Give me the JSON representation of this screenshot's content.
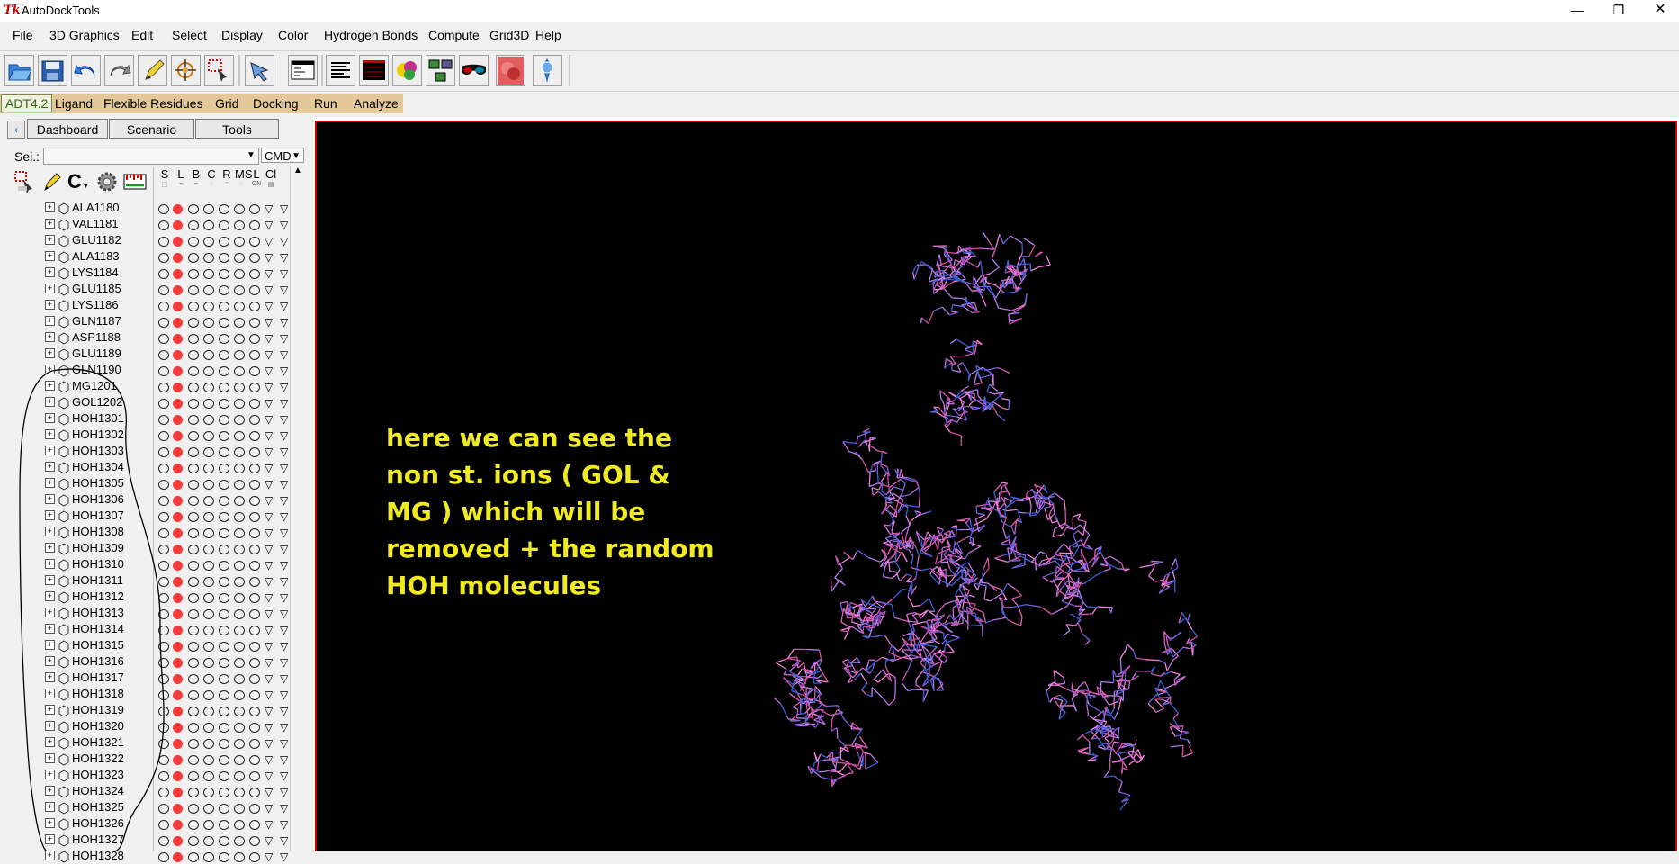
{
  "window": {
    "title": "AutoDockTools",
    "logo": "Tk",
    "controls": [
      "minimize-icon",
      "restore-icon",
      "close-icon"
    ]
  },
  "menubar": [
    "File",
    "3D Graphics",
    "Edit",
    "Select",
    "Display",
    "Color",
    "Hydrogen Bonds",
    "Compute",
    "Grid3D",
    "Help"
  ],
  "adt": {
    "version": "ADT4.2",
    "menus": [
      "Ligand",
      "Flexible Residues",
      "Grid",
      "Docking",
      "Run",
      "Analyze"
    ]
  },
  "tabs": [
    "Dashboard",
    "Scenario",
    "Tools"
  ],
  "selection": {
    "label": "Sel.:",
    "value": "",
    "cmd": "CMD"
  },
  "columns": [
    {
      "h": "S",
      "sub": "⬚"
    },
    {
      "h": "L",
      "sub": "~"
    },
    {
      "h": "B",
      "sub": "~"
    },
    {
      "h": "C",
      "sub": "◌"
    },
    {
      "h": "R",
      "sub": "≈"
    },
    {
      "h": "MS",
      "sub": "◌"
    },
    {
      "h": "L",
      "sub": "ON"
    },
    {
      "h": "Cl",
      "sub": "▤"
    }
  ],
  "residues": [
    "ALA1180",
    "VAL1181",
    "GLU1182",
    "ALA1183",
    "LYS1184",
    "GLU1185",
    "LYS1186",
    "GLN1187",
    "ASP1188",
    "GLU1189",
    "GLN1190",
    "MG1201",
    "GOL1202",
    "HOH1301",
    "HOH1302",
    "HOH1303",
    "HOH1304",
    "HOH1305",
    "HOH1306",
    "HOH1307",
    "HOH1308",
    "HOH1309",
    "HOH1310",
    "HOH1311",
    "HOH1312",
    "HOH1313",
    "HOH1314",
    "HOH1315",
    "HOH1316",
    "HOH1317",
    "HOH1318",
    "HOH1319",
    "HOH1320",
    "HOH1321",
    "HOH1322",
    "HOH1323",
    "HOH1324",
    "HOH1325",
    "HOH1326",
    "HOH1327",
    "HOH1328"
  ],
  "annotation": {
    "lines": [
      "here we can see the",
      "non st. ions ( GOL &",
      "MG ) which will be",
      "removed + the random",
      "HOH molecules"
    ],
    "color": "#f0ea22"
  },
  "colors": {
    "viewer_bg": "#000000",
    "viewer_border": "#cc0000",
    "line_mark": "#f03c3c",
    "adt_bar": "#e3c89a"
  }
}
